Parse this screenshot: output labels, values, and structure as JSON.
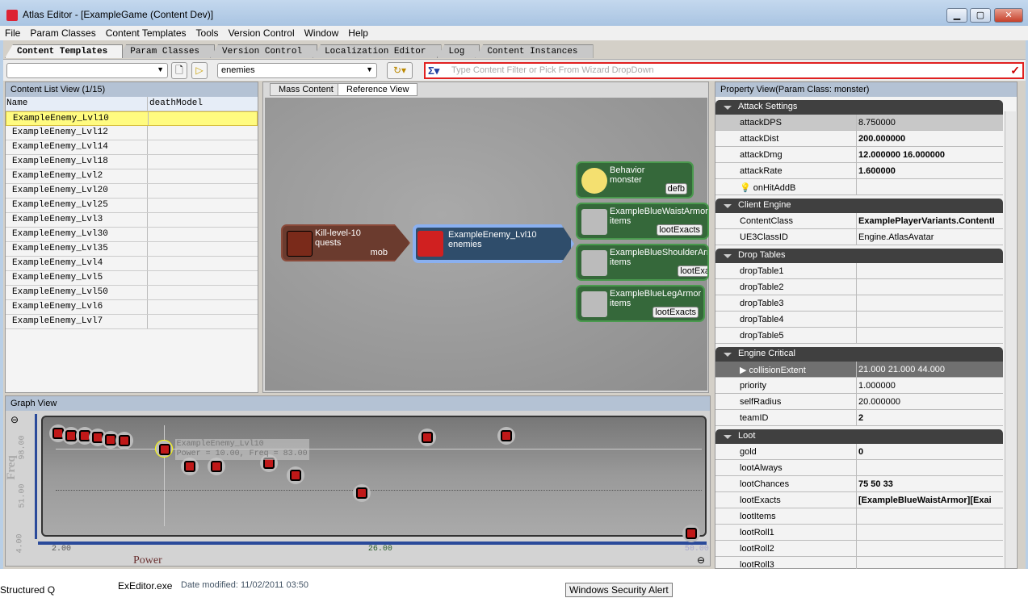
{
  "window": {
    "title": "Atlas Editor - [ExampleGame (Content Dev)]",
    "min": "▁",
    "max": "▢",
    "close": "✕"
  },
  "menu": [
    "File",
    "Param Classes",
    "Content Templates",
    "Tools",
    "Version Control",
    "Window",
    "Help"
  ],
  "tabs": [
    "Content Templates",
    "Param Classes",
    "Version Control",
    "Localization Editor",
    "Log",
    "Content Instances"
  ],
  "toolbar": {
    "combo1": "",
    "combo2": "enemies",
    "filter_placeholder": "Type Content Filter or Pick From Wizard DropDown"
  },
  "content_list": {
    "title": "Content List View (1/15)",
    "columns": [
      "Name",
      "deathModel"
    ],
    "rows": [
      "ExampleEnemy_Lvl10",
      "ExampleEnemy_Lvl12",
      "ExampleEnemy_Lvl14",
      "ExampleEnemy_Lvl18",
      "ExampleEnemy_Lvl2",
      "ExampleEnemy_Lvl20",
      "ExampleEnemy_Lvl25",
      "ExampleEnemy_Lvl3",
      "ExampleEnemy_Lvl30",
      "ExampleEnemy_Lvl35",
      "ExampleEnemy_Lvl4",
      "ExampleEnemy_Lvl5",
      "ExampleEnemy_Lvl50",
      "ExampleEnemy_Lvl6",
      "ExampleEnemy_Lvl7"
    ]
  },
  "center": {
    "tabs": [
      "Mass Content",
      "Reference View"
    ],
    "active_tab": "Reference View",
    "nodes": {
      "quest": {
        "name": "Kill-level-10",
        "type": "quests",
        "tag": "mob"
      },
      "enemy": {
        "name": "ExampleEnemy_Lvl10",
        "type": "enemies"
      },
      "refs": [
        {
          "name": "Behavior",
          "type": "monster",
          "tag": "defb"
        },
        {
          "name": "ExampleBlueWaistArmor",
          "type": "items",
          "tag": "lootExacts"
        },
        {
          "name": "ExampleBlueShoulderArmor",
          "type": "items",
          "tag": "lootExacts"
        },
        {
          "name": "ExampleBlueLegArmor",
          "type": "items",
          "tag": "lootExacts"
        }
      ]
    }
  },
  "property_view": {
    "title": "Property View(Param Class: monster)",
    "sections": [
      {
        "name": "Attack Settings",
        "rows": [
          [
            "attackDPS",
            "8.750000"
          ],
          [
            "attackDist",
            "200.000000"
          ],
          [
            "attackDmg",
            "12.000000 16.000000"
          ],
          [
            "attackRate",
            "1.600000"
          ],
          [
            "onHitAddB",
            ""
          ]
        ]
      },
      {
        "name": "Client Engine",
        "rows": [
          [
            "ContentClass",
            "ExamplePlayerVariants.ContentI"
          ],
          [
            "UE3ClassID",
            "Engine.AtlasAvatar"
          ]
        ]
      },
      {
        "name": "Drop Tables",
        "rows": [
          [
            "dropTable1",
            ""
          ],
          [
            "dropTable2",
            ""
          ],
          [
            "dropTable3",
            ""
          ],
          [
            "dropTable4",
            ""
          ],
          [
            "dropTable5",
            ""
          ]
        ]
      },
      {
        "name": "Engine Critical",
        "rows": [
          [
            "collisionExtent",
            "21.000 21.000 44.000"
          ],
          [
            "priority",
            "1.000000"
          ],
          [
            "selfRadius",
            "20.000000"
          ],
          [
            "teamID",
            "2"
          ]
        ]
      },
      {
        "name": "Loot",
        "rows": [
          [
            "gold",
            "0"
          ],
          [
            "lootAlways",
            ""
          ],
          [
            "lootChances",
            "75 50 33"
          ],
          [
            "lootExacts",
            "[ExampleBlueWaistArmor][Exai"
          ],
          [
            "lootItems",
            ""
          ],
          [
            "lootRoll1",
            ""
          ],
          [
            "lootRoll2",
            ""
          ],
          [
            "lootRoll3",
            ""
          ]
        ]
      }
    ]
  },
  "graph": {
    "title": "Graph View",
    "tooltip": {
      "name": "ExampleEnemy_Lvl10",
      "text": "Power = 10.00, Freq = 83.00"
    }
  },
  "chart_data": {
    "type": "scatter",
    "xlabel": "Power",
    "ylabel": "Freq",
    "xticks": [
      "2.00",
      "26.00",
      "50.00"
    ],
    "yticks": [
      "4.00",
      "51.00",
      "98.00"
    ],
    "xlim": [
      2,
      50
    ],
    "ylim": [
      4,
      98
    ],
    "points": [
      [
        2,
        98
      ],
      [
        3,
        96
      ],
      [
        4,
        96
      ],
      [
        5,
        94
      ],
      [
        6,
        92
      ],
      [
        7,
        91
      ],
      [
        10,
        83
      ],
      [
        12,
        66
      ],
      [
        14,
        66
      ],
      [
        18,
        69
      ],
      [
        20,
        57
      ],
      [
        25,
        40
      ],
      [
        30,
        94
      ],
      [
        36,
        96
      ],
      [
        50,
        0
      ]
    ],
    "selected_index": 6
  },
  "taskbar": {
    "a": "Structured Q",
    "b": "ExEditor.exe",
    "c": "Date modified: 11/02/2011 03:50",
    "d": "Windows Security Alert"
  }
}
